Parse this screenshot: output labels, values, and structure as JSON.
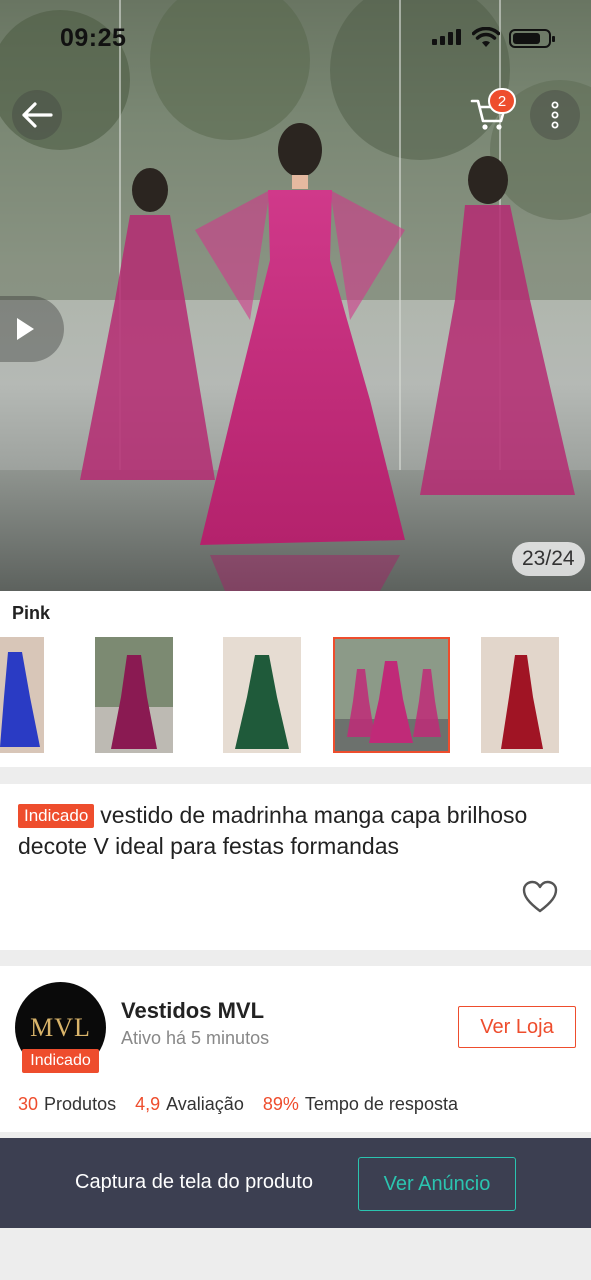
{
  "status_bar": {
    "time": "09:25",
    "battery_level": 0.8
  },
  "header": {
    "cart_count": "2"
  },
  "gallery": {
    "counter": "23/24",
    "current": 23,
    "total": 24
  },
  "variation": {
    "label": "Pink",
    "thumbnails": [
      {
        "color": "#2a3bc4",
        "selected": false
      },
      {
        "color": "#8a1a52",
        "selected": false
      },
      {
        "color": "#1f5a3a",
        "selected": false
      },
      {
        "color": "#c02a78",
        "selected": true
      },
      {
        "color": "#a01424",
        "selected": false
      }
    ]
  },
  "product": {
    "tag": "Indicado",
    "title": "vestido de madrinha manga capa brilhoso decote V ideal para festas formandas"
  },
  "shop": {
    "logo_text": "MVL",
    "tag": "Indicado",
    "name": "Vestidos MVL",
    "status": "Ativo há 5 minutos",
    "button": "Ver Loja",
    "stats": [
      {
        "value": "30",
        "label": "Produtos"
      },
      {
        "value": "4,9",
        "label": "Avaliação"
      },
      {
        "value": "89%",
        "label": "Tempo de resposta"
      }
    ]
  },
  "bottom_bar": {
    "text": "Captura de tela do produto",
    "button": "Ver Anúncio"
  },
  "colors": {
    "accent": "#ee4d2d",
    "teal": "#2bc4b0",
    "bar": "#3c3f51",
    "dress": "#c42a7c"
  }
}
